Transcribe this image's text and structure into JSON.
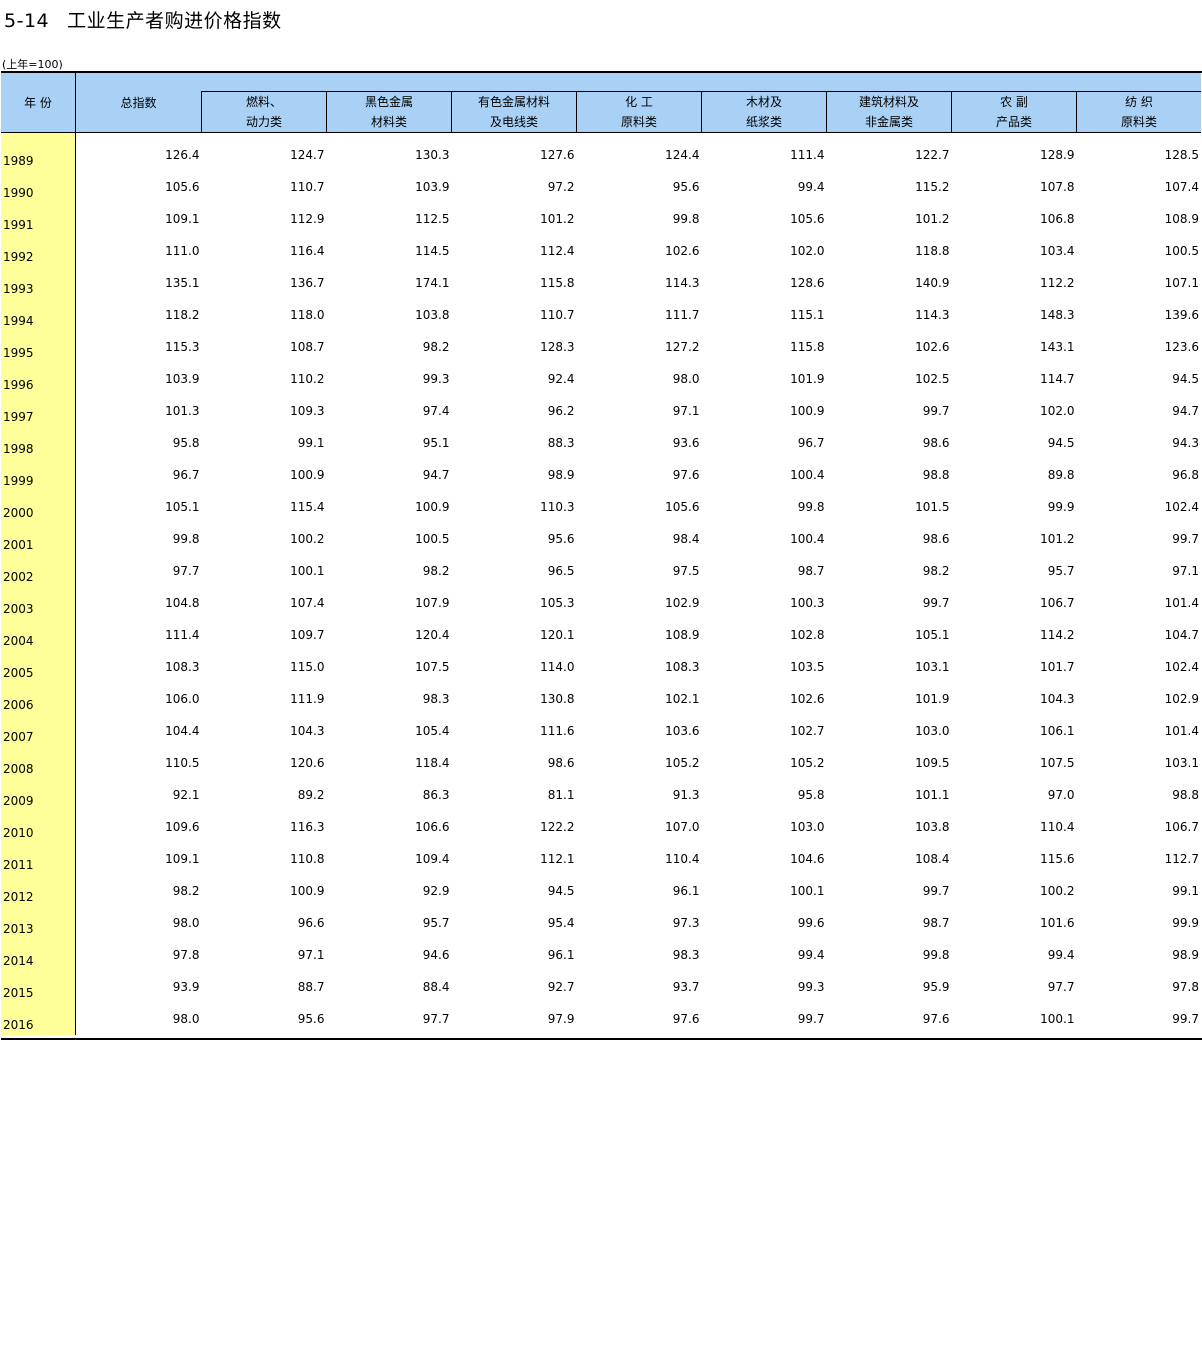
{
  "title": {
    "number": "5-14",
    "text": "工业生产者购进价格指数"
  },
  "unit": "(上年=100)",
  "header": {
    "year": "年 份",
    "total": "总指数",
    "columns": [
      {
        "l1": "燃料、",
        "l2": "动力类"
      },
      {
        "l1": "黑色金属",
        "l2": "材料类"
      },
      {
        "l1": "有色金属材料",
        "l2": "及电线类"
      },
      {
        "l1": "化 工",
        "l2": "原料类"
      },
      {
        "l1": "木材及",
        "l2": "纸浆类"
      },
      {
        "l1": "建筑材料及",
        "l2": "非金属类"
      },
      {
        "l1": "农 副",
        "l2": "产品类"
      },
      {
        "l1": "纺 织",
        "l2": "原料类"
      }
    ]
  },
  "rows": [
    [
      "1989",
      "126.4",
      "124.7",
      "130.3",
      "127.6",
      "124.4",
      "111.4",
      "122.7",
      "128.9",
      "128.5"
    ],
    [
      "1990",
      "105.6",
      "110.7",
      "103.9",
      "97.2",
      "95.6",
      "99.4",
      "115.2",
      "107.8",
      "107.4"
    ],
    [
      "1991",
      "109.1",
      "112.9",
      "112.5",
      "101.2",
      "99.8",
      "105.6",
      "101.2",
      "106.8",
      "108.9"
    ],
    [
      "1992",
      "111.0",
      "116.4",
      "114.5",
      "112.4",
      "102.6",
      "102.0",
      "118.8",
      "103.4",
      "100.5"
    ],
    [
      "1993",
      "135.1",
      "136.7",
      "174.1",
      "115.8",
      "114.3",
      "128.6",
      "140.9",
      "112.2",
      "107.1"
    ],
    [
      "1994",
      "118.2",
      "118.0",
      "103.8",
      "110.7",
      "111.7",
      "115.1",
      "114.3",
      "148.3",
      "139.6"
    ],
    [
      "1995",
      "115.3",
      "108.7",
      "98.2",
      "128.3",
      "127.2",
      "115.8",
      "102.6",
      "143.1",
      "123.6"
    ],
    [
      "1996",
      "103.9",
      "110.2",
      "99.3",
      "92.4",
      "98.0",
      "101.9",
      "102.5",
      "114.7",
      "94.5"
    ],
    [
      "1997",
      "101.3",
      "109.3",
      "97.4",
      "96.2",
      "97.1",
      "100.9",
      "99.7",
      "102.0",
      "94.7"
    ],
    [
      "1998",
      "95.8",
      "99.1",
      "95.1",
      "88.3",
      "93.6",
      "96.7",
      "98.6",
      "94.5",
      "94.3"
    ],
    [
      "1999",
      "96.7",
      "100.9",
      "94.7",
      "98.9",
      "97.6",
      "100.4",
      "98.8",
      "89.8",
      "96.8"
    ],
    [
      "2000",
      "105.1",
      "115.4",
      "100.9",
      "110.3",
      "105.6",
      "99.8",
      "101.5",
      "99.9",
      "102.4"
    ],
    [
      "2001",
      "99.8",
      "100.2",
      "100.5",
      "95.6",
      "98.4",
      "100.4",
      "98.6",
      "101.2",
      "99.7"
    ],
    [
      "2002",
      "97.7",
      "100.1",
      "98.2",
      "96.5",
      "97.5",
      "98.7",
      "98.2",
      "95.7",
      "97.1"
    ],
    [
      "2003",
      "104.8",
      "107.4",
      "107.9",
      "105.3",
      "102.9",
      "100.3",
      "99.7",
      "106.7",
      "101.4"
    ],
    [
      "2004",
      "111.4",
      "109.7",
      "120.4",
      "120.1",
      "108.9",
      "102.8",
      "105.1",
      "114.2",
      "104.7"
    ],
    [
      "2005",
      "108.3",
      "115.0",
      "107.5",
      "114.0",
      "108.3",
      "103.5",
      "103.1",
      "101.7",
      "102.4"
    ],
    [
      "2006",
      "106.0",
      "111.9",
      "98.3",
      "130.8",
      "102.1",
      "102.6",
      "101.9",
      "104.3",
      "102.9"
    ],
    [
      "2007",
      "104.4",
      "104.3",
      "105.4",
      "111.6",
      "103.6",
      "102.7",
      "103.0",
      "106.1",
      "101.4"
    ],
    [
      "2008",
      "110.5",
      "120.6",
      "118.4",
      "98.6",
      "105.2",
      "105.2",
      "109.5",
      "107.5",
      "103.1"
    ],
    [
      "2009",
      "92.1",
      "89.2",
      "86.3",
      "81.1",
      "91.3",
      "95.8",
      "101.1",
      "97.0",
      "98.8"
    ],
    [
      "2010",
      "109.6",
      "116.3",
      "106.6",
      "122.2",
      "107.0",
      "103.0",
      "103.8",
      "110.4",
      "106.7"
    ],
    [
      "2011",
      "109.1",
      "110.8",
      "109.4",
      "112.1",
      "110.4",
      "104.6",
      "108.4",
      "115.6",
      "112.7"
    ],
    [
      "2012",
      "98.2",
      "100.9",
      "92.9",
      "94.5",
      "96.1",
      "100.1",
      "99.7",
      "100.2",
      "99.1"
    ],
    [
      "2013",
      "98.0",
      "96.6",
      "95.7",
      "95.4",
      "97.3",
      "99.6",
      "98.7",
      "101.6",
      "99.9"
    ],
    [
      "2014",
      "97.8",
      "97.1",
      "94.6",
      "96.1",
      "98.3",
      "99.4",
      "99.8",
      "99.4",
      "98.9"
    ],
    [
      "2015",
      "93.9",
      "88.7",
      "88.4",
      "92.7",
      "93.7",
      "99.3",
      "95.9",
      "97.7",
      "97.8"
    ],
    [
      "2016",
      "98.0",
      "95.6",
      "97.7",
      "97.9",
      "97.6",
      "99.7",
      "97.6",
      "100.1",
      "99.7"
    ]
  ]
}
